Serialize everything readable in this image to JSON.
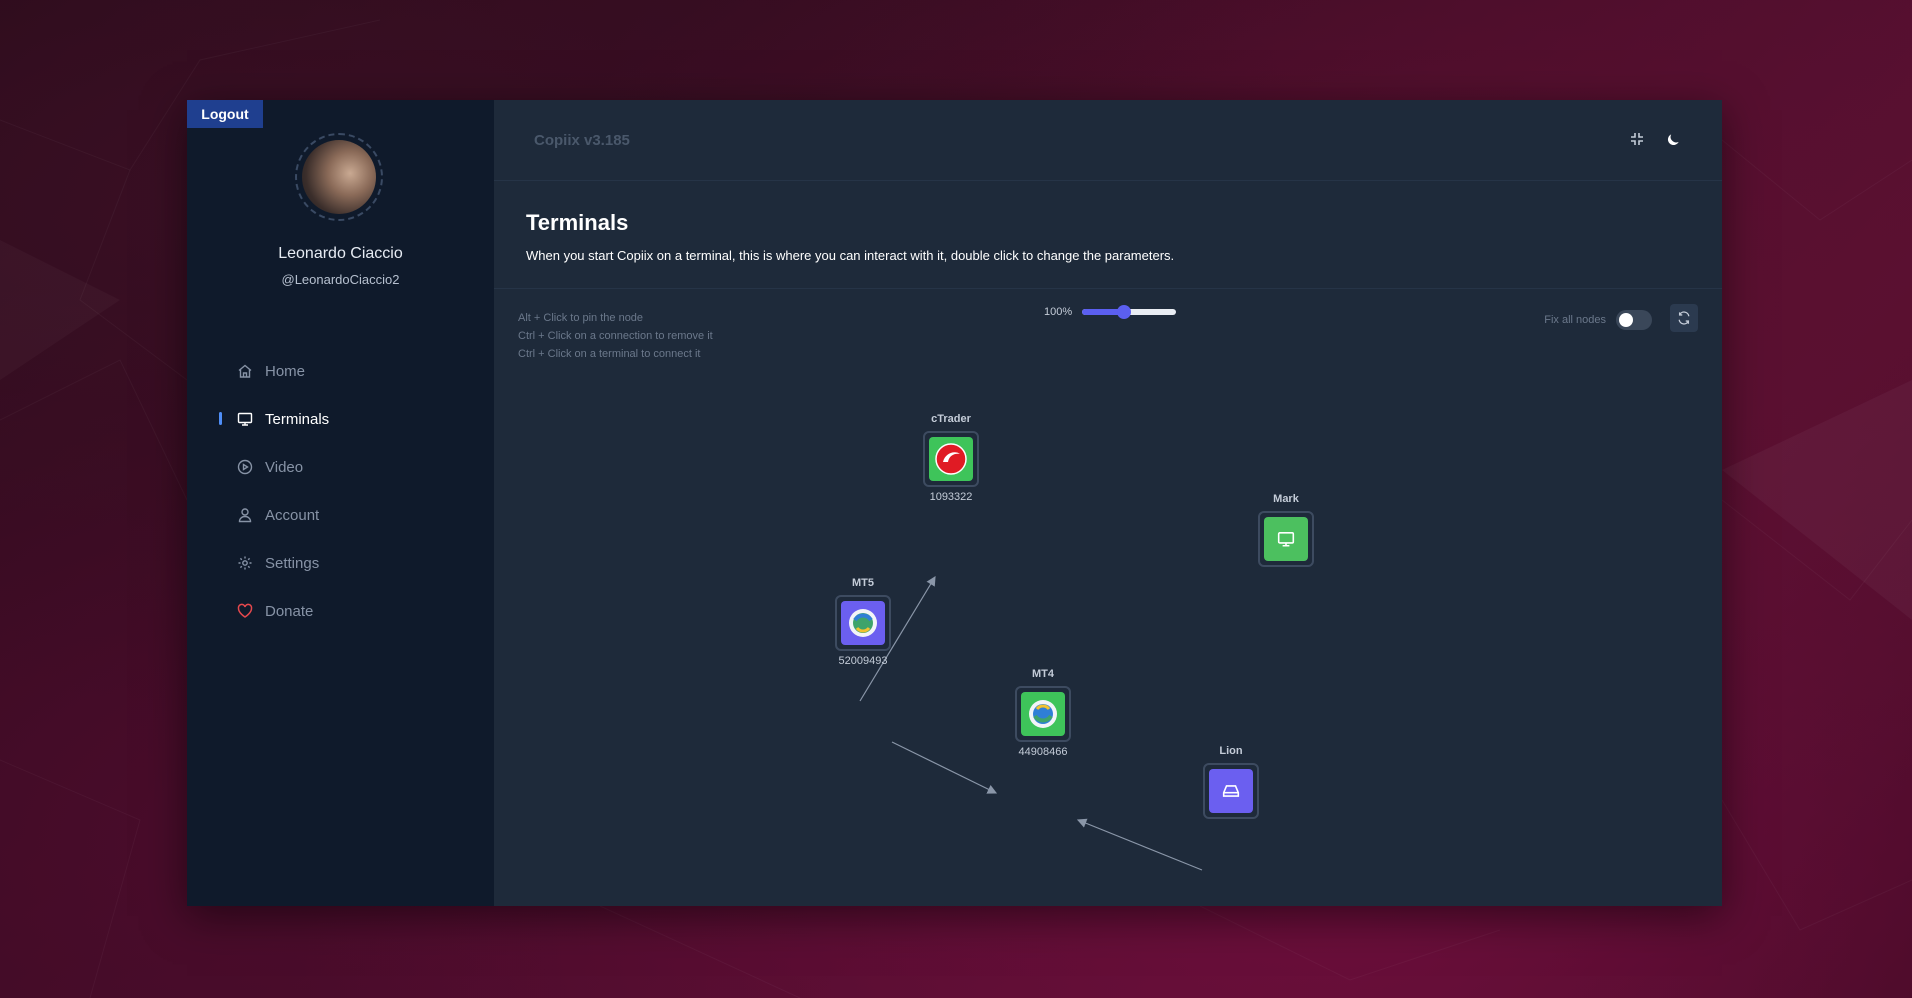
{
  "app": {
    "version": "Copiix v3.185"
  },
  "auth": {
    "logout_label": "Logout"
  },
  "user": {
    "name": "Leonardo Ciaccio",
    "handle": "@LeonardoCiaccio2"
  },
  "sidebar": {
    "items": [
      {
        "label": "Home",
        "icon": "home-icon",
        "active": false
      },
      {
        "label": "Terminals",
        "icon": "monitor-icon",
        "active": true
      },
      {
        "label": "Video",
        "icon": "play-circle-icon",
        "active": false
      },
      {
        "label": "Account",
        "icon": "user-icon",
        "active": false
      },
      {
        "label": "Settings",
        "icon": "gear-icon",
        "active": false
      },
      {
        "label": "Donate",
        "icon": "heart-icon",
        "active": false,
        "color": "#e5484d"
      }
    ]
  },
  "header": {
    "title": "Terminals",
    "description": "When you start Copiix on a terminal, this is where you can interact with it, double click to change the parameters."
  },
  "canvas": {
    "hints": [
      "Alt + Click to pin the node",
      "Ctrl + Click on a connection to remove it",
      "Ctrl + Click on a terminal to connect it"
    ],
    "zoom": {
      "label": "100%",
      "value_fraction": 0.45
    },
    "fix_nodes": {
      "label": "Fix all nodes",
      "enabled": false
    },
    "nodes": [
      {
        "title": "cTrader",
        "id": "1093322",
        "icon": "ctrader-icon",
        "color": "#3ec45a"
      },
      {
        "title": "Mark",
        "id": "",
        "icon": "monitor-icon",
        "color": "#4cc05f"
      },
      {
        "title": "MT5",
        "id": "52009493",
        "icon": "metatrader5-icon",
        "color": "#6b5ff0"
      },
      {
        "title": "MT4",
        "id": "44908466",
        "icon": "metatrader4-icon",
        "color": "#3ec45a"
      },
      {
        "title": "Lion",
        "id": "",
        "icon": "drive-icon",
        "color": "#6b5ff0"
      }
    ],
    "links": [
      {
        "from": "MT5",
        "to": "cTrader"
      },
      {
        "from": "MT5",
        "to": "MT4"
      },
      {
        "from": "Lion",
        "to": "MT4"
      }
    ]
  },
  "colors": {
    "accent": "#5b5ff0",
    "sidebar_bg": "#0f1a2b",
    "main_bg": "#1e2a3a",
    "logout_bg": "#1f3f8f"
  }
}
